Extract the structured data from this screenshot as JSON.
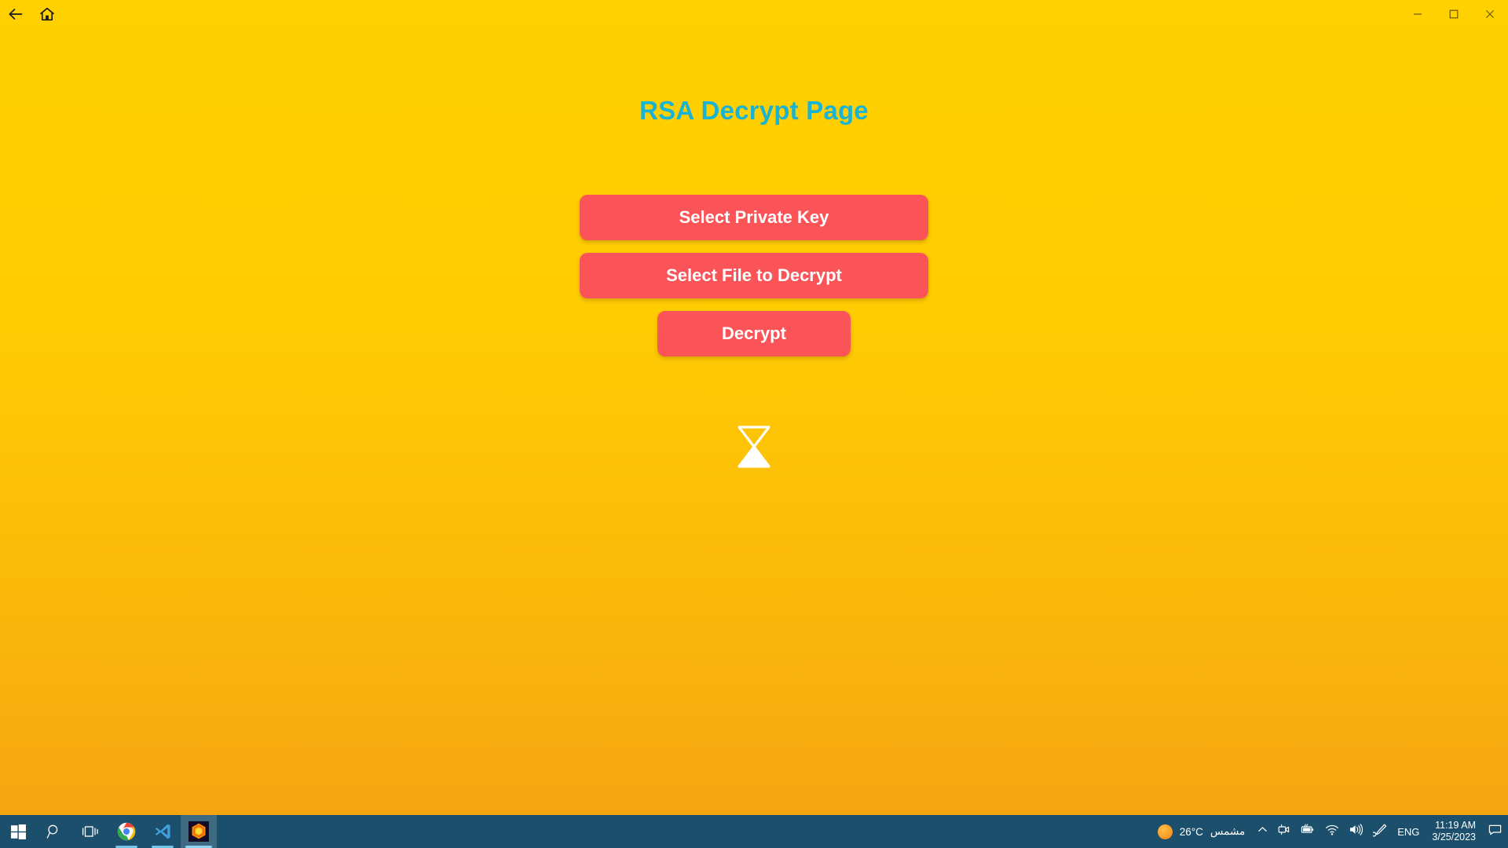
{
  "window": {
    "nav": {
      "back_icon": "arrow-left-icon",
      "home_icon": "home-icon"
    },
    "controls": {
      "minimize_icon": "minimize-icon",
      "maximize_icon": "maximize-icon",
      "close_icon": "close-icon"
    },
    "background_top_color": "#FFD100",
    "background_bottom_color": "#F5A312"
  },
  "page": {
    "title": "RSA Decrypt Page",
    "title_color": "#19B3D4",
    "button_color": "#FB5458",
    "buttons": [
      {
        "label": "Select Private Key",
        "width": "wide"
      },
      {
        "label": "Select File to Decrypt",
        "width": "wide"
      },
      {
        "label": "Decrypt",
        "width": "narrow"
      }
    ],
    "status_icon": "hourglass-icon",
    "status_icon_color": "#FFFFFF"
  },
  "taskbar": {
    "background_color": "#1B4F6B",
    "items": [
      {
        "name": "start-button",
        "icon": "windows-logo-icon",
        "running": false,
        "active": false
      },
      {
        "name": "search-button",
        "icon": "search-icon",
        "running": false,
        "active": false
      },
      {
        "name": "task-view-button",
        "icon": "task-view-icon",
        "running": false,
        "active": false
      },
      {
        "name": "chrome-button",
        "icon": "chrome-icon",
        "running": true,
        "active": false
      },
      {
        "name": "vscode-button",
        "icon": "vscode-icon",
        "running": true,
        "active": false
      },
      {
        "name": "app-button",
        "icon": "hex-nut-app-icon",
        "running": true,
        "active": true
      }
    ],
    "tray": {
      "weather": {
        "icon": "sun-icon",
        "temperature": "26°C",
        "description": "مشمس"
      },
      "show_hidden_icons": "chevron-up-icon",
      "icons": [
        {
          "name": "camera-privacy-icon",
          "glyph": "camera"
        },
        {
          "name": "battery-icon",
          "glyph": "battery"
        },
        {
          "name": "wifi-icon",
          "glyph": "wifi"
        },
        {
          "name": "volume-icon",
          "glyph": "volume"
        },
        {
          "name": "pen-ink-icon",
          "glyph": "pen"
        }
      ],
      "language": "ENG",
      "time": "11:19 AM",
      "date": "3/25/2023",
      "notifications_icon": "notification-center-icon"
    }
  }
}
